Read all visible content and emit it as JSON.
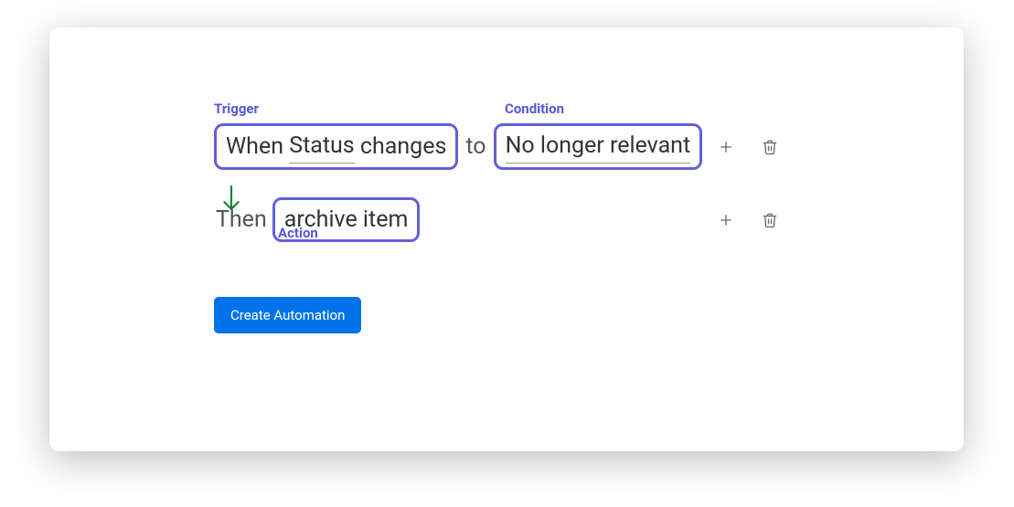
{
  "labels": {
    "trigger": "Trigger",
    "condition": "Condition",
    "action": "Action"
  },
  "rule": {
    "trigger_prefix": "When",
    "trigger_field": "Status",
    "trigger_suffix": "changes",
    "connector": "to",
    "condition_value": "No longer relevant",
    "then": "Then",
    "action_value": "archive item"
  },
  "button": {
    "create": "Create Automation"
  }
}
